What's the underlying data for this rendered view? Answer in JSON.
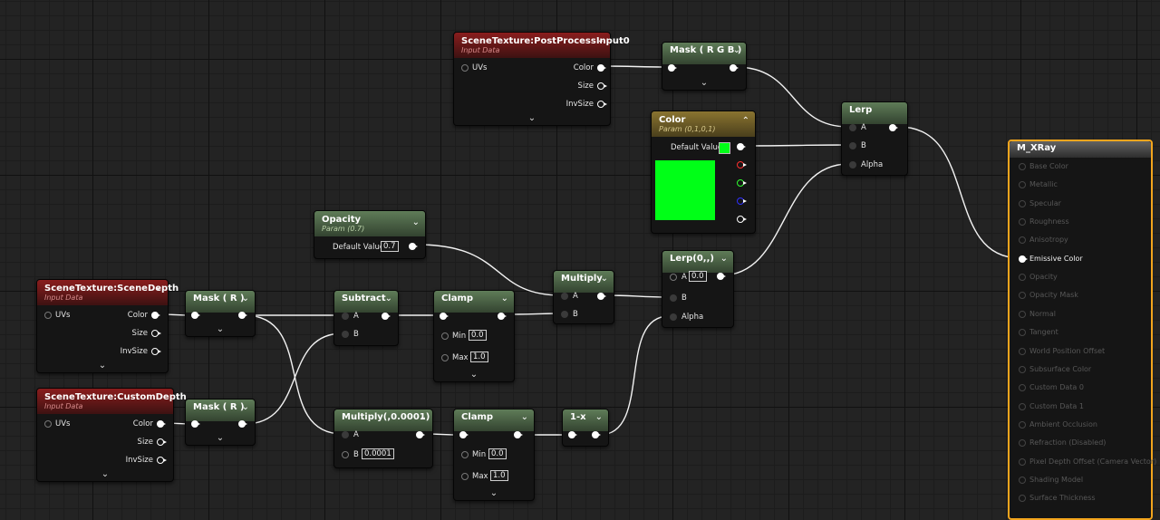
{
  "nodes": {
    "scene_depth": {
      "title": "SceneTexture:SceneDepth",
      "subtitle": "Input Data",
      "inputs": [
        "UVs"
      ],
      "outputs": [
        "Color",
        "Size",
        "InvSize"
      ]
    },
    "custom_depth": {
      "title": "SceneTexture:CustomDepth",
      "subtitle": "Input Data",
      "inputs": [
        "UVs"
      ],
      "outputs": [
        "Color",
        "Size",
        "InvSize"
      ]
    },
    "post_process": {
      "title": "SceneTexture:PostProcessInput0",
      "subtitle": "Input Data",
      "inputs": [
        "UVs"
      ],
      "outputs": [
        "Color",
        "Size",
        "InvSize"
      ]
    },
    "mask_r1": {
      "title": "Mask ( R )"
    },
    "mask_r2": {
      "title": "Mask ( R )"
    },
    "mask_rgb": {
      "title": "Mask ( R G B )"
    },
    "subtract": {
      "title": "Subtract",
      "inputs": [
        "A",
        "B"
      ]
    },
    "multiply_small": {
      "title": "Multiply(,0.0001)",
      "inputs": [
        "A",
        "B"
      ],
      "b_value": "0.0001"
    },
    "clamp1": {
      "title": "Clamp",
      "min_label": "Min",
      "min_value": "0.0",
      "max_label": "Max",
      "max_value": "1.0"
    },
    "clamp2": {
      "title": "Clamp",
      "min_label": "Min",
      "min_value": "0.0",
      "max_label": "Max",
      "max_value": "1.0"
    },
    "opacity": {
      "title": "Opacity",
      "subtitle": "Param (0.7)",
      "label": "Default Value",
      "value": "0.7"
    },
    "multiply": {
      "title": "Multiply",
      "inputs": [
        "A",
        "B"
      ]
    },
    "one_minus_x": {
      "title": "1-x"
    },
    "lerp0": {
      "title": "Lerp(0,,)",
      "inputs": [
        "A",
        "B",
        "Alpha"
      ],
      "a_value": "0.0"
    },
    "color": {
      "title": "Color",
      "subtitle": "Param (0,1,0,1)",
      "label": "Default Value",
      "swatch_color": "#00ff17"
    },
    "lerp": {
      "title": "Lerp",
      "inputs": [
        "A",
        "B",
        "Alpha"
      ]
    }
  },
  "material": {
    "title": "M_XRay",
    "inputs": [
      "Base Color",
      "Metallic",
      "Specular",
      "Roughness",
      "Anisotropy",
      "Emissive Color",
      "Opacity",
      "Opacity Mask",
      "Normal",
      "Tangent",
      "World Position Offset",
      "Subsurface Color",
      "Custom Data 0",
      "Custom Data 1",
      "Ambient Occlusion",
      "Refraction (Disabled)",
      "Pixel Depth Offset (Camera Vector)",
      "Shading Model",
      "Surface Thickness"
    ],
    "active_input": "Emissive Color"
  }
}
